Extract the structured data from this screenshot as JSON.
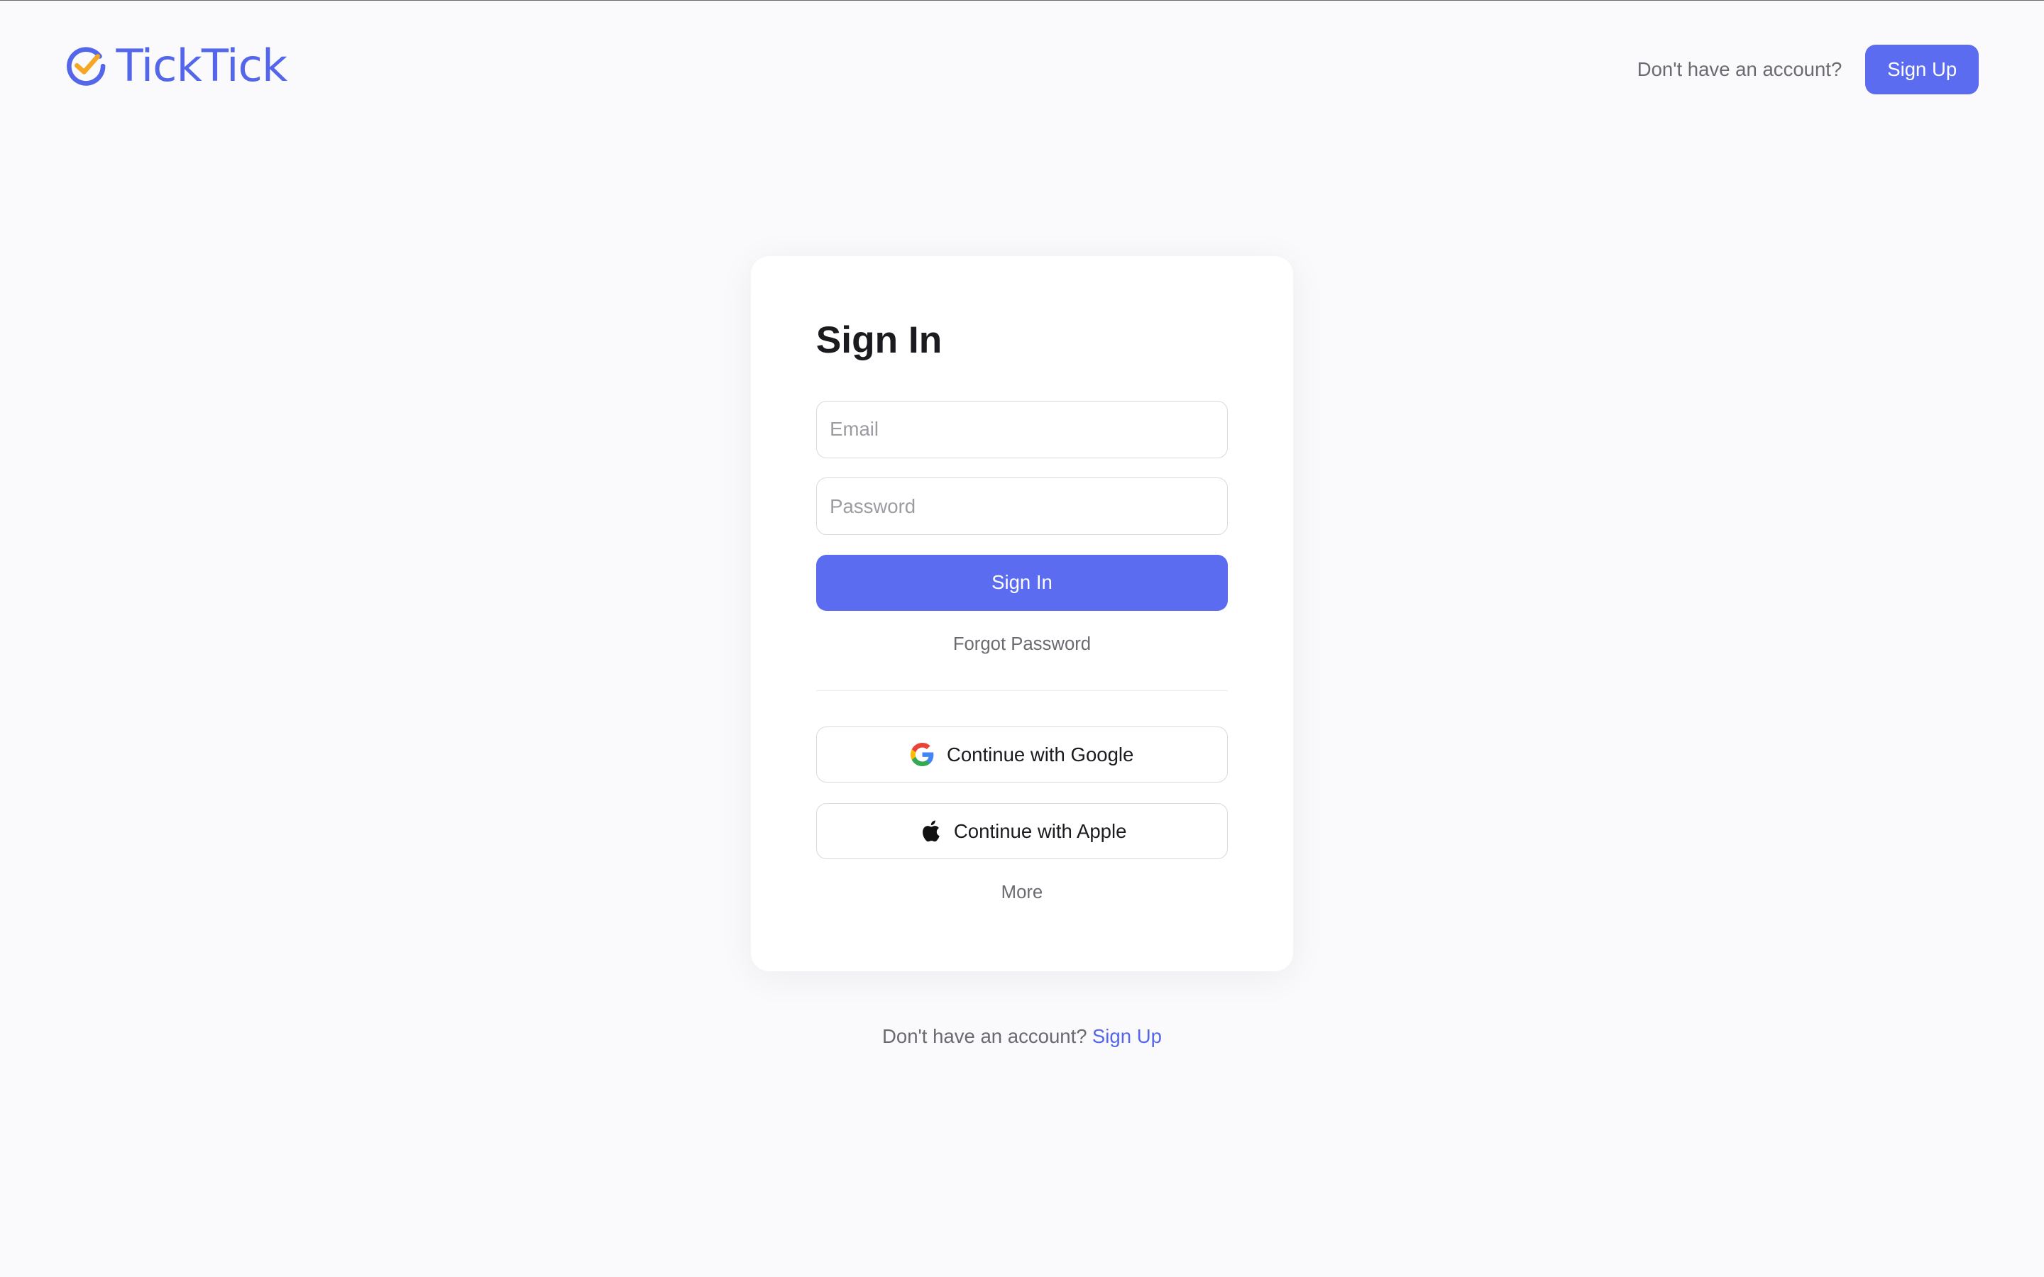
{
  "brand": {
    "name": "TickTick",
    "accent": "#5b6cf0",
    "check_color": "#f5a623"
  },
  "header": {
    "prompt": "Don't have an account?",
    "signup_label": "Sign Up"
  },
  "form": {
    "title": "Sign In",
    "email_placeholder": "Email",
    "password_placeholder": "Password",
    "submit_label": "Sign In",
    "forgot_label": "Forgot Password",
    "google_label": "Continue with Google",
    "apple_label": "Continue with Apple",
    "more_label": "More"
  },
  "footer": {
    "prompt": "Don't have an account?",
    "signup_label": "Sign Up"
  },
  "icons": {
    "logo": "ticktick-logo-icon",
    "google": "google-icon",
    "apple": "apple-icon"
  }
}
